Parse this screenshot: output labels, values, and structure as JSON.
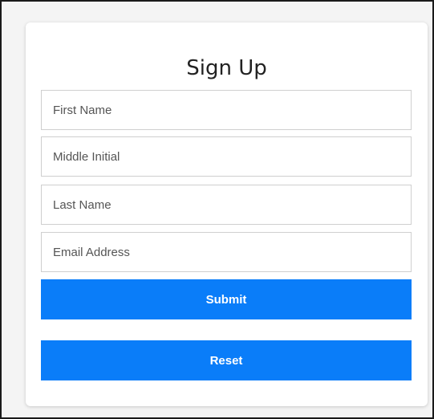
{
  "form": {
    "title": "Sign Up",
    "fields": [
      {
        "placeholder": "First Name",
        "value": ""
      },
      {
        "placeholder": "Middle Initial",
        "value": ""
      },
      {
        "placeholder": "Last Name",
        "value": ""
      },
      {
        "placeholder": "Email Address",
        "value": ""
      }
    ],
    "submit_label": "Submit",
    "reset_label": "Reset",
    "accent_color": "#0a7df9"
  }
}
